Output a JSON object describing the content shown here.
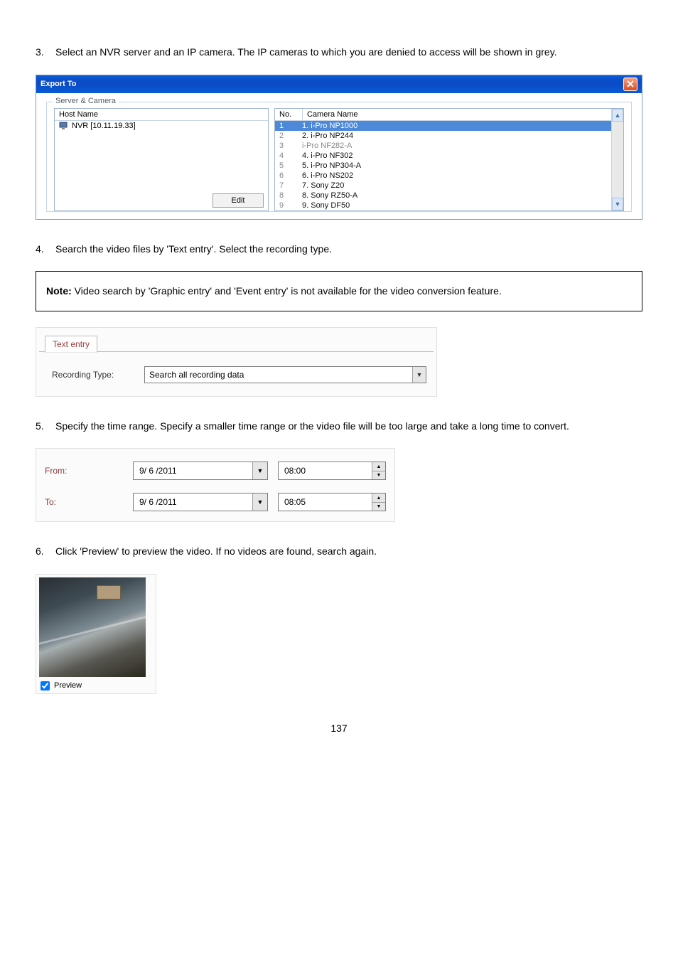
{
  "steps": {
    "s3": {
      "num": "3.",
      "text": "Select an NVR server and an IP camera.   The IP cameras to which you are denied to access will be shown in grey."
    },
    "s4": {
      "num": "4.",
      "text": "Search the video files by 'Text entry'.   Select the recording type."
    },
    "s5": {
      "num": "5.",
      "text": "Specify the time range.   Specify a smaller time range or the video file will be too large and take a long time to convert."
    },
    "s6": {
      "num": "6.",
      "text": "Click 'Preview' to preview the video.   If no videos are found, search again."
    }
  },
  "dialog": {
    "title": "Export To",
    "group_legend": "Server & Camera",
    "host_hdr": "Host Name",
    "no_hdr": "No.",
    "cam_hdr": "Camera Name",
    "host_item": "NVR [10.11.19.33]",
    "edit_label": "Edit",
    "cameras": [
      {
        "no": "1",
        "name": "1. i-Pro NP1000",
        "sel": true
      },
      {
        "no": "2",
        "name": "2. i-Pro NP244"
      },
      {
        "no": "3",
        "name": "i-Pro NF282-A",
        "grey": true
      },
      {
        "no": "4",
        "name": "4. i-Pro NF302"
      },
      {
        "no": "5",
        "name": "5. i-Pro NP304-A"
      },
      {
        "no": "6",
        "name": "6. i-Pro NS202"
      },
      {
        "no": "7",
        "name": "7. Sony Z20"
      },
      {
        "no": "8",
        "name": "8. Sony RZ50-A"
      },
      {
        "no": "9",
        "name": "9. Sony DF50"
      }
    ]
  },
  "note": {
    "label": "Note:",
    "text": " Video search by 'Graphic entry' and 'Event entry' is not available for the video conversion feature."
  },
  "text_entry": {
    "tab_label": "Text entry",
    "rec_label": "Recording Type:",
    "rec_value": "Search all recording data"
  },
  "time": {
    "from_label": "From:",
    "to_label": "To:",
    "from_date": "9/ 6 /2011",
    "from_time": "08:00",
    "to_date": "9/ 6 /2011",
    "to_time": "08:05"
  },
  "preview": {
    "label": "Preview"
  },
  "page_number": "137"
}
